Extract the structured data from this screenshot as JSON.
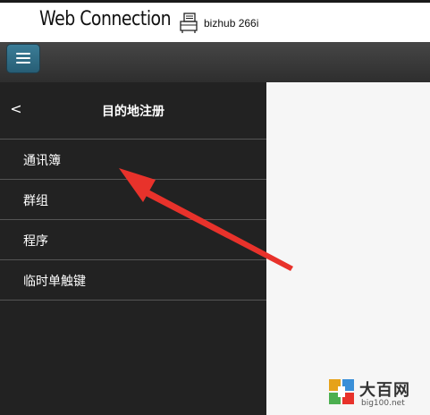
{
  "header": {
    "app_title": "Web Connection",
    "device_icon": "printer-icon",
    "device_name": "bizhub 266i"
  },
  "toolbar": {
    "menu_icon": "hamburger-menu-icon",
    "accent_color": "#2f6f88"
  },
  "side_panel": {
    "back_icon": "chevron-left-icon",
    "back_glyph": "<",
    "title": "目的地注册",
    "items": [
      {
        "label": "通讯簿"
      },
      {
        "label": "群组"
      },
      {
        "label": "程序"
      },
      {
        "label": "临时单触键"
      }
    ],
    "background_color": "#222222"
  },
  "annotation": {
    "arrow_color": "#e8322b"
  },
  "watermark": {
    "brand": "大百网",
    "url": "big100.net"
  }
}
